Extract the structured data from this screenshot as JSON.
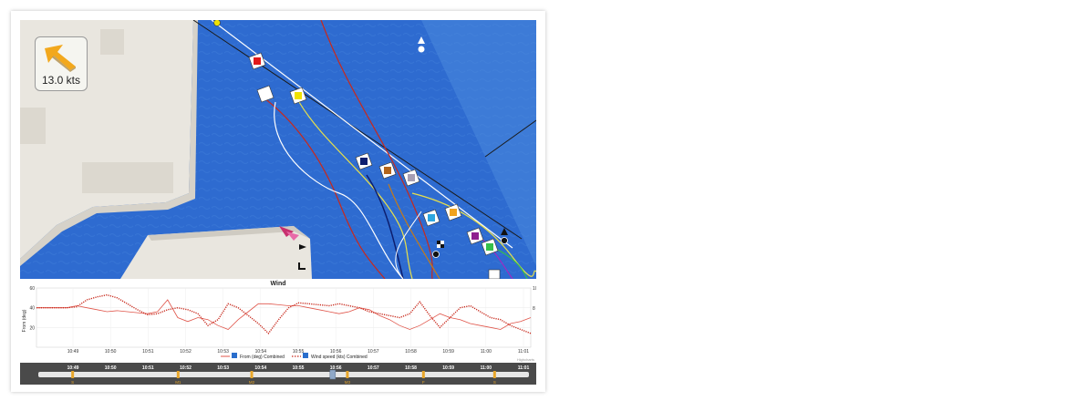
{
  "map": {
    "wind_speed": "13.0 kts",
    "colors": {
      "water": "#2e6bd0",
      "water_light": "#4a88dc",
      "land": "#e9e6df",
      "line": "#1a1a1a"
    },
    "icons": [
      "wind-arrow-icon",
      "north-marker-icon",
      "pin-marker-icon",
      "finish-flag-icon",
      "start-flag-icon"
    ]
  },
  "chart_data": {
    "type": "line",
    "title": "Wind",
    "ylabel": "From (deg)",
    "ylim": [
      0,
      60
    ],
    "yticks": [
      20,
      40,
      60
    ],
    "y2ticks": [
      "10",
      "8"
    ],
    "xticks": [
      "10:49",
      "10:50",
      "10:51",
      "10:52",
      "10:53",
      "10:54",
      "10:55",
      "10:56",
      "10:57",
      "10:58",
      "10:59",
      "11:00",
      "11:01"
    ],
    "series": [
      {
        "name": "From (deg) Combined",
        "style": "solid",
        "color": "#e0554a",
        "values": [
          40,
          40,
          40,
          40,
          42,
          40,
          38,
          36,
          37,
          36,
          35,
          34,
          36,
          48,
          30,
          26,
          30,
          28,
          22,
          18,
          28,
          36,
          44,
          44,
          43,
          42,
          42,
          40,
          38,
          36,
          34,
          36,
          40,
          38,
          32,
          28,
          22,
          18,
          22,
          28,
          34,
          30,
          28,
          24,
          22,
          20,
          18,
          24,
          26,
          30
        ]
      },
      {
        "name": "Wind speed (kts) Combined",
        "style": "dotted",
        "color": "#c8291c",
        "values": [
          40,
          40,
          40,
          40,
          41,
          48,
          51,
          53,
          50,
          44,
          38,
          33,
          34,
          38,
          40,
          38,
          34,
          22,
          28,
          44,
          40,
          32,
          24,
          14,
          28,
          40,
          45,
          44,
          43,
          42,
          44,
          42,
          40,
          36,
          34,
          32,
          30,
          34,
          46,
          32,
          20,
          30,
          40,
          42,
          36,
          30,
          28,
          22,
          18,
          14
        ]
      }
    ],
    "legend": [
      "From (deg) Combined",
      "Wind speed (kts) Combined"
    ],
    "credit": "Highcharts"
  },
  "timeline": {
    "times": [
      "10:49",
      "10:50",
      "10:51",
      "10:52",
      "10:53",
      "10:54",
      "10:55",
      "10:56",
      "10:57",
      "10:58",
      "10:59",
      "11:00",
      "11:01"
    ],
    "markers": [
      {
        "label": "S",
        "pos": 0.07
      },
      {
        "label": "M1",
        "pos": 0.285
      },
      {
        "label": "M2",
        "pos": 0.435
      },
      {
        "label": "M3",
        "pos": 0.63
      },
      {
        "label": "F",
        "pos": 0.785
      },
      {
        "label": "S",
        "pos": 0.93
      }
    ],
    "current": 0.6
  }
}
